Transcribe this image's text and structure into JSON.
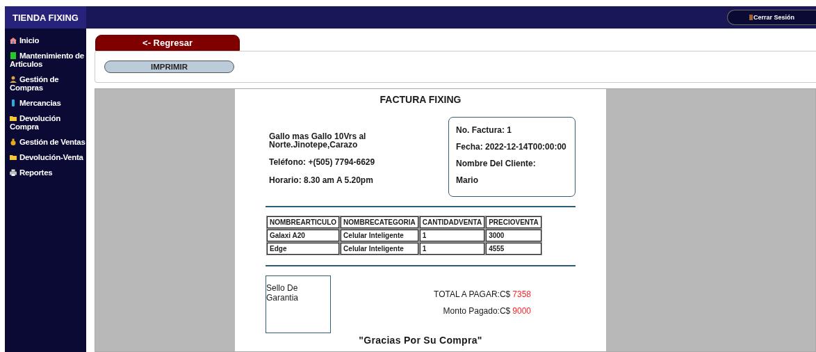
{
  "brand": "TIENDA FIXING",
  "logout": "Cerrar Sesión",
  "sidebar": {
    "items": [
      {
        "label": "Inicio"
      },
      {
        "label": "Mantenimiento de Articulos"
      },
      {
        "label": "Gestión de Compras"
      },
      {
        "label": "Mercancias"
      },
      {
        "label": "Devolución Compra"
      },
      {
        "label": "Gestión de Ventas"
      },
      {
        "label": "Devolución-Venta"
      },
      {
        "label": "Reportes"
      }
    ]
  },
  "back_button": "<- Regresar",
  "print_button": "IMPRIMIR",
  "invoice": {
    "title": "FACTURA FIXING",
    "address": "Gallo mas Gallo 10Vrs al Norte.Jinotepe,Carazo",
    "phone": "Teléfono: +(505) 7794-6629",
    "hours": "Horario: 8.30 am A 5.20pm",
    "details": [
      "No. Factura: 1",
      "Fecha: 2022-12-14T00:00:00",
      "Nombre Del Cliente:",
      "Mario"
    ],
    "table": {
      "columns": [
        "NOMBREARTICULO",
        "NOMBRECATEGORIA",
        "CANTIDADVENTA",
        "PRECIOVENTA"
      ],
      "rows": [
        [
          "Galaxi A20",
          "Celular Inteligente",
          "1",
          "3000"
        ],
        [
          "Edge",
          "Celular Inteligente",
          "1",
          "4555"
        ]
      ]
    },
    "seal": "Sello De Garantia",
    "totals": [
      {
        "label": "TOTAL A PAGAR:C$",
        "value": "7358"
      },
      {
        "label": "Monto Pagado:C$",
        "value": "9000"
      }
    ],
    "thanks": "\"Gracias Por Su Compra\""
  }
}
